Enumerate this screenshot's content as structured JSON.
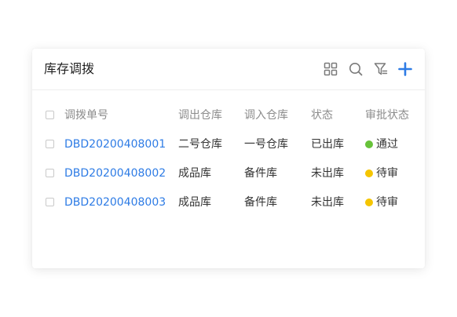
{
  "card": {
    "title": "库存调拨"
  },
  "toolbar": {
    "icons": [
      "grid-icon",
      "search-icon",
      "filter-icon",
      "add-icon"
    ],
    "accent_color": "#2d7be5"
  },
  "table": {
    "columns": [
      "调拨单号",
      "调出仓库",
      "调入仓库",
      "状态",
      "审批状态"
    ],
    "rows": [
      {
        "id": "DBD20200408001",
        "from": "二号仓库",
        "to": "一号仓库",
        "status": "已出库",
        "approval": "通过",
        "approval_color": "#67c23a"
      },
      {
        "id": "DBD20200408002",
        "from": "成品库",
        "to": "备件库",
        "status": "未出库",
        "approval": "待审",
        "approval_color": "#f5c500"
      },
      {
        "id": "DBD20200408003",
        "from": "成品库",
        "to": "备件库",
        "status": "未出库",
        "approval": "待审",
        "approval_color": "#f5c500"
      }
    ]
  }
}
